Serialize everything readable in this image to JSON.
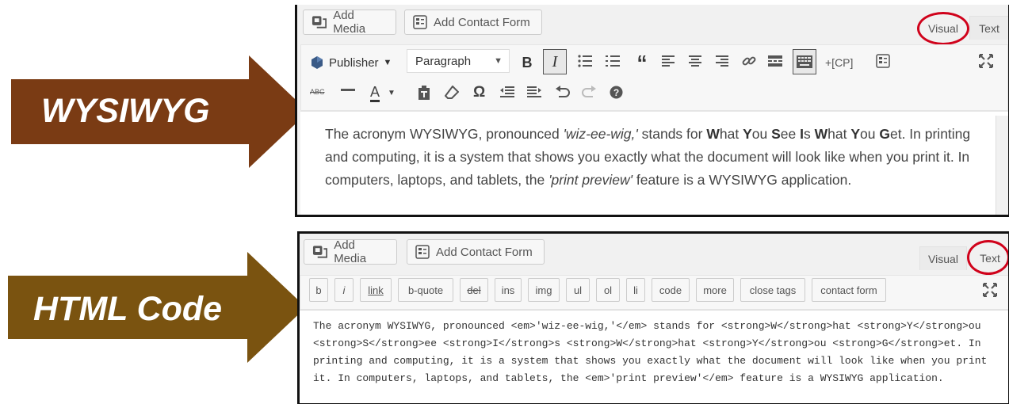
{
  "arrows": [
    {
      "label": "WYSIWYG",
      "color": "#7a3b14"
    },
    {
      "label": "HTML Code",
      "color": "#7a5310"
    }
  ],
  "visual_editor": {
    "add_media_label": "Add Media",
    "add_contact_form_label": "Add Contact Form",
    "tab_visual": "Visual",
    "tab_text": "Text",
    "active_tab": "Visual",
    "publisher_label": "Publisher",
    "format_select_value": "Paragraph",
    "custom_shortcode_label": "+[CP]",
    "toolbar_row1_icons": [
      "bold-icon",
      "italic-icon",
      "bullet-list-icon",
      "numbered-list-icon",
      "blockquote-icon",
      "align-left-icon",
      "align-center-icon",
      "align-right-icon",
      "link-icon",
      "read-more-icon",
      "toolbar-toggle-icon",
      "contact-form-icon",
      "fullscreen-icon"
    ],
    "toolbar_row2_icons": [
      "strikethrough-icon",
      "horizontal-line-icon",
      "text-color-icon",
      "paste-text-icon",
      "clear-formatting-icon",
      "special-character-icon",
      "outdent-icon",
      "indent-icon",
      "undo-icon",
      "redo-icon",
      "help-icon"
    ],
    "content": {
      "part1": "The acronym WYSIWYG, pronounced ",
      "em1": "'wiz-ee-wig,'",
      "part2": " stands for ",
      "s_w1": "W",
      "t_hat1": "hat ",
      "s_y1": "Y",
      "t_ou1": "ou ",
      "s_s": "S",
      "t_ee": "ee ",
      "s_i": "I",
      "t_s": "s ",
      "s_w2": "W",
      "t_hat2": "hat ",
      "s_y2": "Y",
      "t_ou2": "ou ",
      "s_g": "G",
      "t_et": "et. In printing and computing, it is a system that shows you exactly what the document will look like when you print it. In computers, laptops, and tablets, the ",
      "em2": "'print preview'",
      "part3": " feature is a WYSIWYG application."
    }
  },
  "text_editor": {
    "add_media_label": "Add Media",
    "add_contact_form_label": "Add Contact Form",
    "tab_visual": "Visual",
    "tab_text": "Text",
    "active_tab": "Text",
    "quicktags": [
      "b",
      "i",
      "link",
      "b-quote",
      "del",
      "ins",
      "img",
      "ul",
      "ol",
      "li",
      "code",
      "more",
      "close tags",
      "contact form"
    ],
    "content": "The acronym WYSIWYG, pronounced <em>'wiz-ee-wig,'</em> stands for <strong>W</strong>hat <strong>Y</strong>ou <strong>S</strong>ee <strong>I</strong>s <strong>W</strong>hat <strong>Y</strong>ou <strong>G</strong>et. In printing and computing, it is a system that shows you exactly what the document will look like when you print it. In computers, laptops, and tablets, the <em>'print preview'</em> feature is a WYSIWYG application."
  },
  "colors": {
    "highlight_ring": "#d0021b",
    "editor_border": "#111111"
  }
}
